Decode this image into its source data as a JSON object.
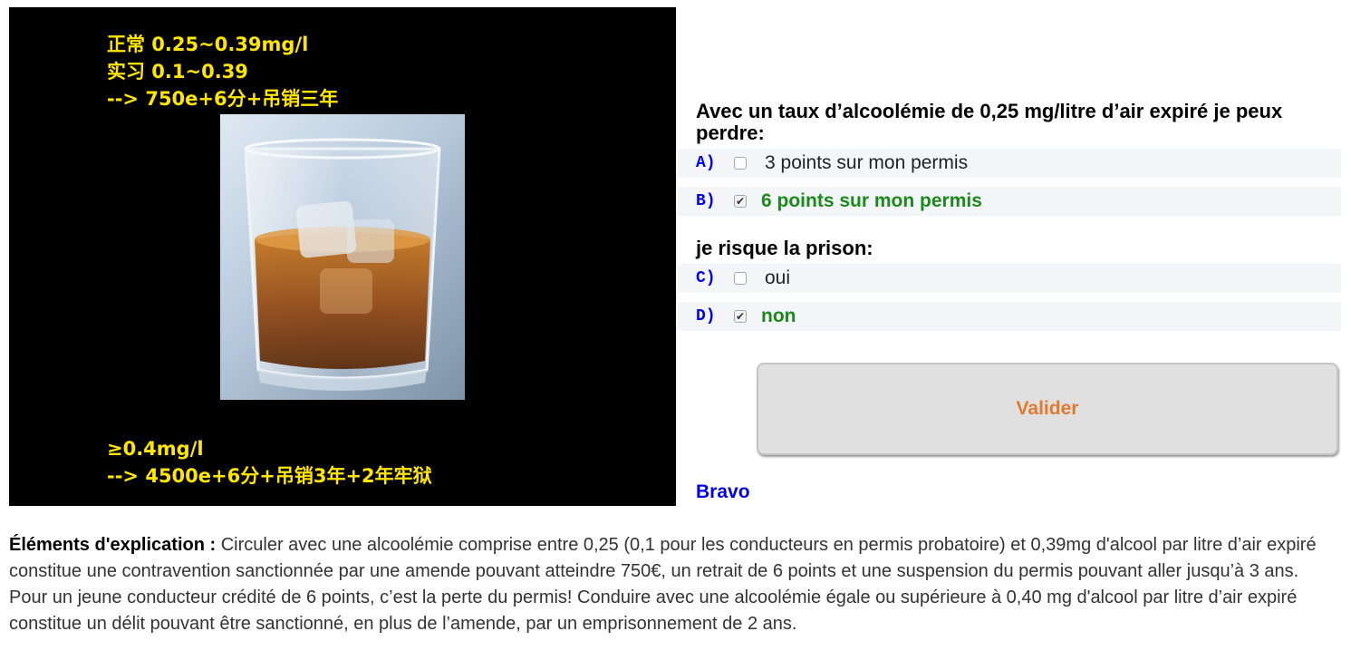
{
  "left_panel": {
    "notes_top": "正常 0.25~0.39mg/l\n实习 0.1~0.39\n--> 750e+6分+吊销三年",
    "notes_bottom": "≥0.4mg/l\n--> 4500e+6分+吊销3年+2年牢狱",
    "image_icon": "whisky-glass-icon",
    "text_color": "#ffe600",
    "background": "#000000"
  },
  "question1": {
    "text": "Avec un taux d’alcoolémie de 0,25 mg/litre d’air expiré je peux perdre:",
    "options": [
      {
        "letter": "A)",
        "label": "3 points sur mon permis",
        "checked": false,
        "correct": false
      },
      {
        "letter": "B)",
        "label": "6 points sur mon permis",
        "checked": true,
        "correct": true
      }
    ]
  },
  "question2": {
    "text": "je risque la prison:",
    "options": [
      {
        "letter": "C)",
        "label": "oui",
        "checked": false,
        "correct": false
      },
      {
        "letter": "D)",
        "label": "non",
        "checked": true,
        "correct": true
      }
    ]
  },
  "validate_button": {
    "label": "Valider"
  },
  "result": {
    "text": "Bravo"
  },
  "explanation": {
    "lead": "Éléments d'explication : ",
    "body": " Circuler avec une alcoolémie comprise entre 0,25 (0,1 pour les conducteurs en permis probatoire) et 0,39mg d'alcool par litre d’air expiré constitue une contravention sanctionnée par une amende pouvant atteindre 750€, un retrait de 6 points et une suspension du permis pouvant aller jusqu’à 3 ans. Pour un jeune conducteur crédité de 6 points, c’est la perte du permis! Conduire avec une alcoolémie égale ou supérieure à 0,40 mg d'alcool par litre d’air expiré constitue un délit pouvant être sanctionné, en plus de l’amende, par un emprisonnement de 2 ans."
  },
  "colors": {
    "correct": "#1a8a1a",
    "letters": "#0000ee",
    "button_text": "#e07a2f",
    "option_bg": "#f4f5f9"
  }
}
